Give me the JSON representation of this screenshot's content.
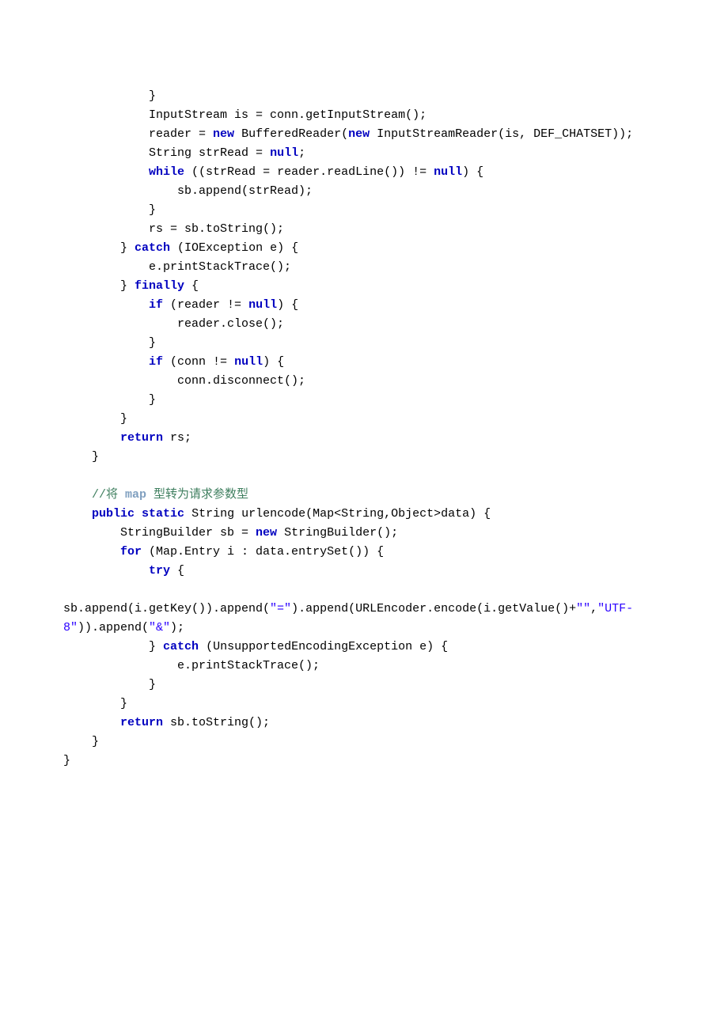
{
  "code": {
    "tokens": [
      {
        "t": "            }\n",
        "c": ""
      },
      {
        "t": "            InputStream is = conn.getInputStream();\n",
        "c": ""
      },
      {
        "t": "            reader = ",
        "c": ""
      },
      {
        "t": "new",
        "c": "kw"
      },
      {
        "t": " BufferedReader(",
        "c": ""
      },
      {
        "t": "new",
        "c": "kw"
      },
      {
        "t": " InputStreamReader(is, DEF_CHATSET));\n",
        "c": ""
      },
      {
        "t": "            String strRead = ",
        "c": ""
      },
      {
        "t": "null",
        "c": "kw"
      },
      {
        "t": ";\n",
        "c": ""
      },
      {
        "t": "            ",
        "c": ""
      },
      {
        "t": "while",
        "c": "kw"
      },
      {
        "t": " ((strRead = reader.readLine()) != ",
        "c": ""
      },
      {
        "t": "null",
        "c": "kw"
      },
      {
        "t": ") {\n",
        "c": ""
      },
      {
        "t": "                sb.append(strRead);\n",
        "c": ""
      },
      {
        "t": "            }\n",
        "c": ""
      },
      {
        "t": "            rs = sb.toString();\n",
        "c": ""
      },
      {
        "t": "        } ",
        "c": ""
      },
      {
        "t": "catch",
        "c": "kw"
      },
      {
        "t": " (IOException e) {\n",
        "c": ""
      },
      {
        "t": "            e.printStackTrace();\n",
        "c": ""
      },
      {
        "t": "        } ",
        "c": ""
      },
      {
        "t": "finally",
        "c": "kw"
      },
      {
        "t": " {\n",
        "c": ""
      },
      {
        "t": "            ",
        "c": ""
      },
      {
        "t": "if",
        "c": "kw"
      },
      {
        "t": " (reader != ",
        "c": ""
      },
      {
        "t": "null",
        "c": "kw"
      },
      {
        "t": ") {\n",
        "c": ""
      },
      {
        "t": "                reader.close();\n",
        "c": ""
      },
      {
        "t": "            }\n",
        "c": ""
      },
      {
        "t": "            ",
        "c": ""
      },
      {
        "t": "if",
        "c": "kw"
      },
      {
        "t": " (conn != ",
        "c": ""
      },
      {
        "t": "null",
        "c": "kw"
      },
      {
        "t": ") {\n",
        "c": ""
      },
      {
        "t": "                conn.disconnect();\n",
        "c": ""
      },
      {
        "t": "            }\n",
        "c": ""
      },
      {
        "t": "        }\n",
        "c": ""
      },
      {
        "t": "        ",
        "c": ""
      },
      {
        "t": "return",
        "c": "kw"
      },
      {
        "t": " rs;\n",
        "c": ""
      },
      {
        "t": "    }\n",
        "c": ""
      },
      {
        "t": "\n",
        "c": ""
      },
      {
        "t": "    ",
        "c": ""
      },
      {
        "t": "//将 ",
        "c": "cmt"
      },
      {
        "t": "map",
        "c": "cmt-kw"
      },
      {
        "t": " 型转为请求参数型",
        "c": "cmt"
      },
      {
        "t": "\n",
        "c": ""
      },
      {
        "t": "    ",
        "c": ""
      },
      {
        "t": "public",
        "c": "kw"
      },
      {
        "t": " ",
        "c": ""
      },
      {
        "t": "static",
        "c": "kw"
      },
      {
        "t": " String urlencode(Map<String,Object>data) {\n",
        "c": ""
      },
      {
        "t": "        StringBuilder sb = ",
        "c": ""
      },
      {
        "t": "new",
        "c": "kw"
      },
      {
        "t": " StringBuilder();\n",
        "c": ""
      },
      {
        "t": "        ",
        "c": ""
      },
      {
        "t": "for",
        "c": "kw"
      },
      {
        "t": " (Map.Entry i : data.entrySet()) {\n",
        "c": ""
      },
      {
        "t": "            ",
        "c": ""
      },
      {
        "t": "try",
        "c": "kw"
      },
      {
        "t": " {\n",
        "c": ""
      },
      {
        "t": "                sb.append(i.getKey()).append(",
        "c": ""
      },
      {
        "t": "\"=\"",
        "c": "str"
      },
      {
        "t": ").append(URLEncoder.encode(i.getValue()+",
        "c": ""
      },
      {
        "t": "\"\"",
        "c": "str"
      },
      {
        "t": ",",
        "c": ""
      },
      {
        "t": "\"UTF-8\"",
        "c": "str"
      },
      {
        "t": ")).append(",
        "c": ""
      },
      {
        "t": "\"&\"",
        "c": "str"
      },
      {
        "t": ");\n",
        "c": ""
      },
      {
        "t": "            } ",
        "c": ""
      },
      {
        "t": "catch",
        "c": "kw"
      },
      {
        "t": " (UnsupportedEncodingException e) {\n",
        "c": ""
      },
      {
        "t": "                e.printStackTrace();\n",
        "c": ""
      },
      {
        "t": "            }\n",
        "c": ""
      },
      {
        "t": "        }\n",
        "c": ""
      },
      {
        "t": "        ",
        "c": ""
      },
      {
        "t": "return",
        "c": "kw"
      },
      {
        "t": " sb.toString();\n",
        "c": ""
      },
      {
        "t": "    }\n",
        "c": ""
      },
      {
        "t": "}\n",
        "c": ""
      }
    ]
  }
}
